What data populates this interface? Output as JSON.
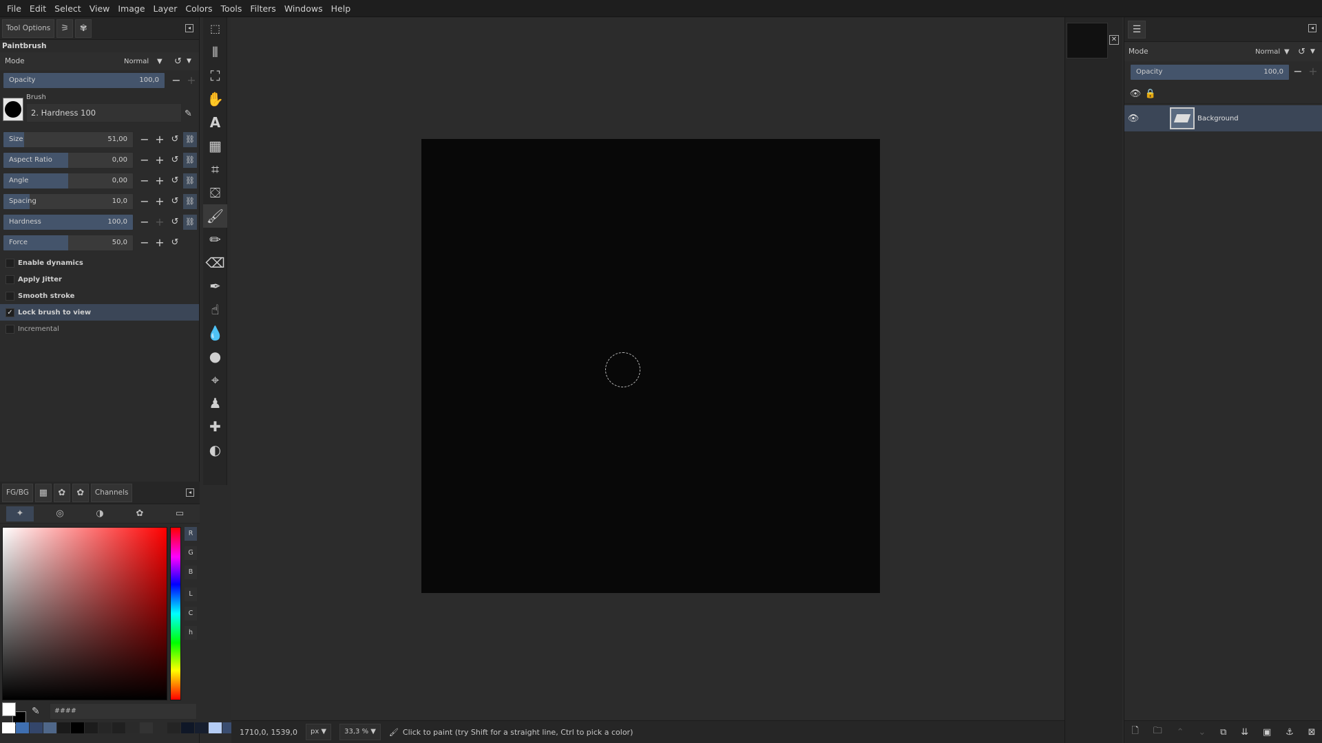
{
  "menu": [
    "File",
    "Edit",
    "Select",
    "View",
    "Image",
    "Layer",
    "Colors",
    "Tools",
    "Filters",
    "Windows",
    "Help"
  ],
  "left_dock": {
    "tabs": {
      "tool_options": "Tool Options"
    },
    "tool_title": "Paintbrush",
    "mode": {
      "label": "Mode",
      "value": "Normal"
    },
    "opacity": {
      "label": "Opacity",
      "value": "100,0",
      "fraction": 1.0
    },
    "brush": {
      "label": "Brush",
      "name": "2. Hardness 100"
    },
    "sliders": [
      {
        "label": "Size",
        "value": "51,00",
        "fraction": 0.16,
        "chain": true
      },
      {
        "label": "Aspect Ratio",
        "value": "0,00",
        "fraction": 0.5,
        "chain": true
      },
      {
        "label": "Angle",
        "value": "0,00",
        "fraction": 0.5,
        "chain": true
      },
      {
        "label": "Spacing",
        "value": "10,0",
        "fraction": 0.2,
        "chain": true
      },
      {
        "label": "Hardness",
        "value": "100,0",
        "fraction": 1.0,
        "chain": true
      },
      {
        "label": "Force",
        "value": "50,0",
        "fraction": 0.5,
        "chain": false
      }
    ],
    "options": [
      {
        "label": "Enable dynamics",
        "checked": false,
        "active": false,
        "dim": false
      },
      {
        "label": "Apply Jitter",
        "checked": false,
        "active": false,
        "dim": false
      },
      {
        "label": "Smooth stroke",
        "checked": false,
        "active": false,
        "dim": false
      },
      {
        "label": "Lock brush to view",
        "checked": true,
        "active": true,
        "dim": false
      },
      {
        "label": "Incremental",
        "checked": false,
        "active": false,
        "dim": true
      }
    ]
  },
  "colors_dock": {
    "tabs": {
      "fgbg": "FG/BG",
      "channels": "Channels"
    },
    "channels": [
      "R",
      "G",
      "B",
      "L",
      "C",
      "h"
    ],
    "hex_label": "####",
    "fg_color": "#ffffff",
    "bg_color": "#000000",
    "palette": [
      "#ffffff",
      "#3f6fb0",
      "#34466a",
      "#4f6789",
      "#1a1a1a",
      "#000000",
      "#1c1c1c",
      "#262626",
      "#202020",
      "#2a2a2a",
      "#333333",
      "#2b2b2b",
      "#242424",
      "#0f1727",
      "#161e2e",
      "#b5cdf5",
      "#3a4d70"
    ]
  },
  "status": {
    "coords": "1710,0, 1539,0",
    "unit": "px",
    "zoom": "33,3 %",
    "message": "Click to paint (try Shift for a straight line, Ctrl to pick a color)"
  },
  "right_dock": {
    "mode": {
      "label": "Mode",
      "value": "Normal"
    },
    "opacity": {
      "label": "Opacity",
      "value": "100,0",
      "fraction": 1.0
    },
    "layers": [
      {
        "name": "Background"
      }
    ]
  },
  "colors": {
    "accent": "#3b4657",
    "canvas_image": "#080808",
    "panel_bg": "#2b2b2b"
  }
}
